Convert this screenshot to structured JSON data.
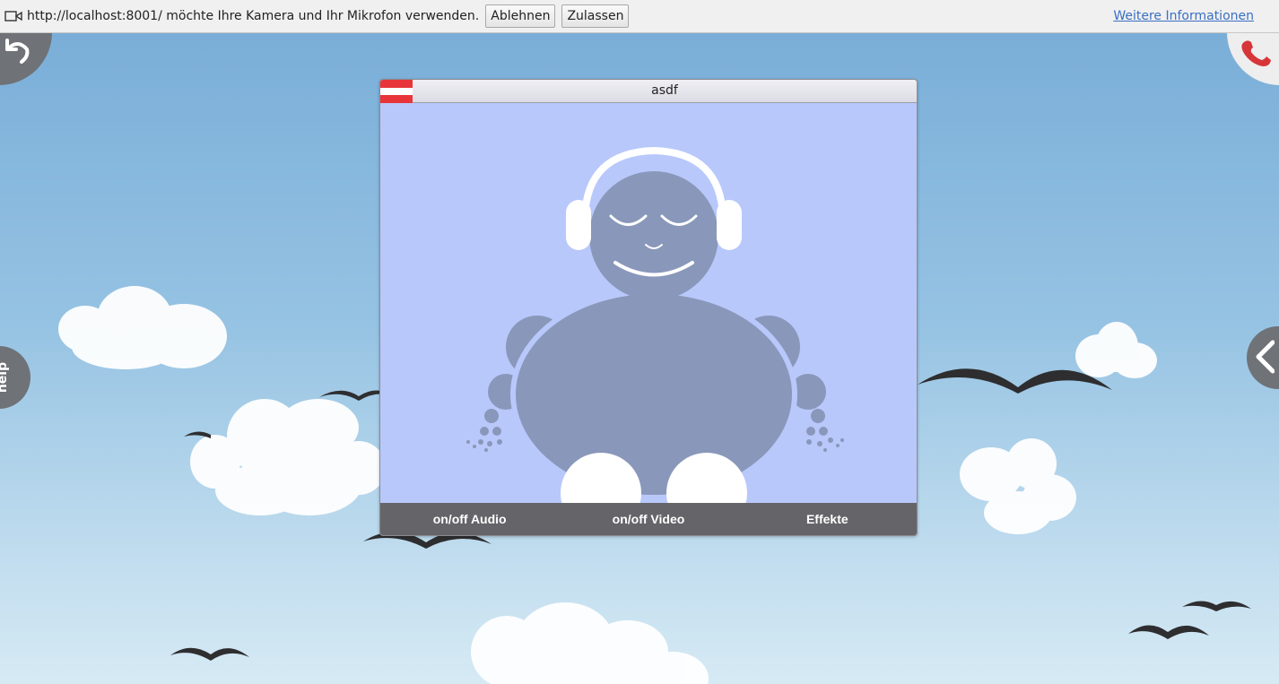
{
  "permission_bar": {
    "icon": "camera-icon",
    "message": "http://localhost:8001/ möchte Ihre Kamera und Ihr Mikrofon verwenden.",
    "deny_label": "Ablehnen",
    "allow_label": "Zulassen",
    "more_info_label": "Weitere Informationen"
  },
  "sidebar": {
    "help_label": "help"
  },
  "video_panel": {
    "participant_name": "asdf",
    "flag_colors": [
      "#e8353a",
      "#ffffff",
      "#e8353a"
    ],
    "controls": {
      "audio_label": "on/off Audio",
      "video_label": "on/off Video",
      "effects_label": "Effekte"
    }
  },
  "colors": {
    "sky_top": "#7aaed8",
    "sky_bottom": "#d6eaf4",
    "panel_bg": "#b8c8fb",
    "avatar": "#8997ba",
    "controls_bar": "#646469",
    "hangup_red": "#d6363a"
  }
}
